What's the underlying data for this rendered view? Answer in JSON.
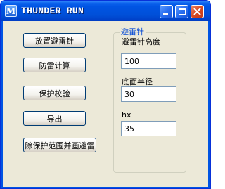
{
  "window": {
    "title": "THUNDER RUN",
    "icon_glyph": "M",
    "colors": {
      "titlebar": "#0054e3",
      "client": "#ece9d8",
      "close_button": "#d94b21",
      "group_title": "#0046d5"
    }
  },
  "buttons": {
    "place_rod": "放置避雷针",
    "calc_protection": "防雷计算",
    "protection_check": "保护校验",
    "export": "导出",
    "remove_and_draw": "除保护范围并画避雷"
  },
  "rod_group": {
    "title": "避雷针",
    "height_label": "避雷针高度",
    "height_value": "100",
    "radius_label": "底面半径",
    "radius_value": "30",
    "hx_label": "hx",
    "hx_value": "35"
  },
  "icons": {
    "app": "app-icon",
    "minimize": "minimize-icon",
    "maximize": "maximize-icon",
    "close": "close-icon"
  }
}
